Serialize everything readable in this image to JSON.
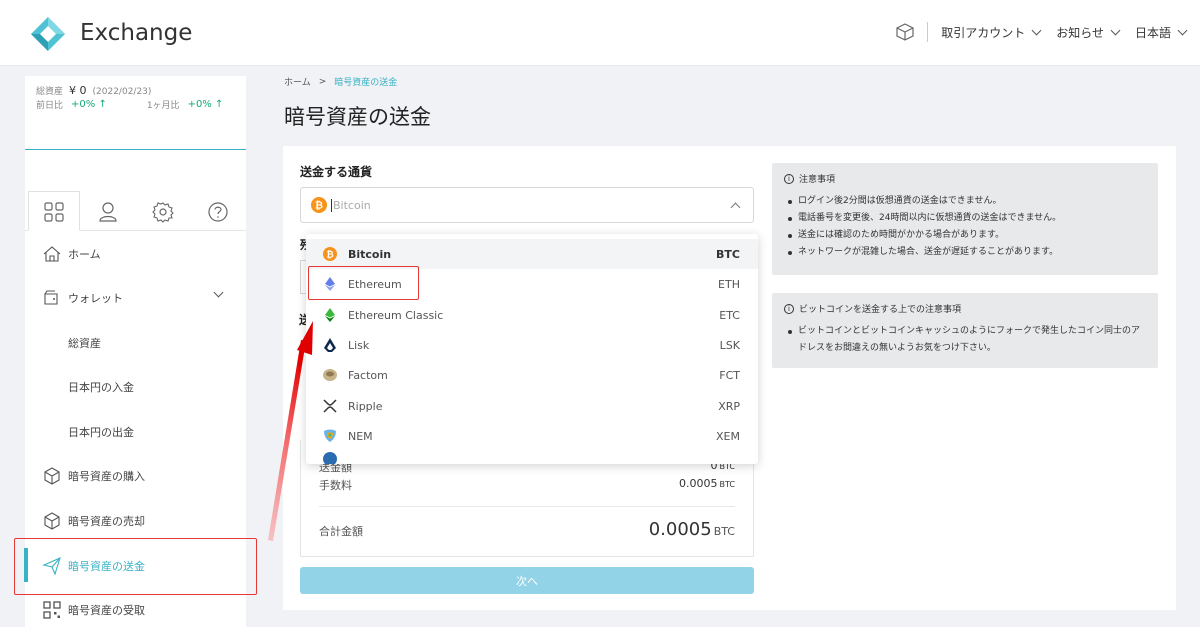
{
  "header": {
    "app_name": "Exchange",
    "menu": [
      {
        "label": "取引アカウント"
      },
      {
        "label": "お知らせ"
      },
      {
        "label": "日本語"
      }
    ]
  },
  "sidebar": {
    "assets": {
      "total_label": "総資産",
      "total_value": "¥ 0",
      "date": "(2022/02/23)",
      "day_label": "前日比",
      "day_change": "+0%",
      "month_label": "1ヶ月比",
      "month_change": "+0%"
    },
    "items": [
      {
        "label": "ホーム"
      },
      {
        "label": "ウォレット"
      },
      {
        "label": "総資産"
      },
      {
        "label": "日本円の入金"
      },
      {
        "label": "日本円の出金"
      },
      {
        "label": "暗号資産の購入"
      },
      {
        "label": "暗号資産の売却"
      },
      {
        "label": "暗号資産の送金"
      },
      {
        "label": "暗号資産の受取"
      }
    ]
  },
  "breadcrumb": {
    "home": "ホーム",
    "sep": ">",
    "current": "暗号資産の送金"
  },
  "page": {
    "title": "暗号資産の送金",
    "currency_label": "送金する通貨",
    "currency_placeholder": "Bitcoin",
    "hidden_label_1": "残",
    "hidden_label_2": "送"
  },
  "dropdown": {
    "options": [
      {
        "name": "Bitcoin",
        "code": "BTC",
        "icon": "bitcoin-icon",
        "color": "#f7931a"
      },
      {
        "name": "Ethereum",
        "code": "ETH",
        "icon": "ethereum-icon",
        "color": "#627eea"
      },
      {
        "name": "Ethereum Classic",
        "code": "ETC",
        "icon": "ethereum-classic-icon",
        "color": "#3ab83a"
      },
      {
        "name": "Lisk",
        "code": "LSK",
        "icon": "lisk-icon",
        "color": "#0d2a4d"
      },
      {
        "name": "Factom",
        "code": "FCT",
        "icon": "factom-icon",
        "color": "#b79d6f"
      },
      {
        "name": "Ripple",
        "code": "XRP",
        "icon": "ripple-icon",
        "color": "#333333"
      },
      {
        "name": "NEM",
        "code": "XEM",
        "icon": "nem-icon",
        "color": "#f7a800"
      }
    ]
  },
  "summary": {
    "amount_label": "送金額",
    "amount_value": "0",
    "amount_unit": "BTC",
    "fee_label": "手数料",
    "fee_value": "0.0005",
    "fee_unit": "BTC",
    "total_label": "合計金額",
    "total_value": "0.0005",
    "total_unit": "BTC",
    "next_button": "次へ"
  },
  "notices": [
    {
      "title": "注意事項",
      "items": [
        "ログイン後2分間は仮想通貨の送金はできません。",
        "電話番号を変更後、24時間以内に仮想通貨の送金はできません。",
        "送金には確認のため時間がかかる場合があります。",
        "ネットワークが混雑した場合、送金が遅延することがあります。"
      ]
    },
    {
      "title": "ビットコインを送金する上での注意事項",
      "items": [
        "ビットコインとビットコインキャッシュのようにフォークで発生したコイン同士のアドレスをお間違えの無いようお気をつけ下さい。"
      ]
    }
  ],
  "colors": {
    "accent": "#38b2c6",
    "highlight_box": "#e53935",
    "button_disabled": "#93d3e7"
  }
}
